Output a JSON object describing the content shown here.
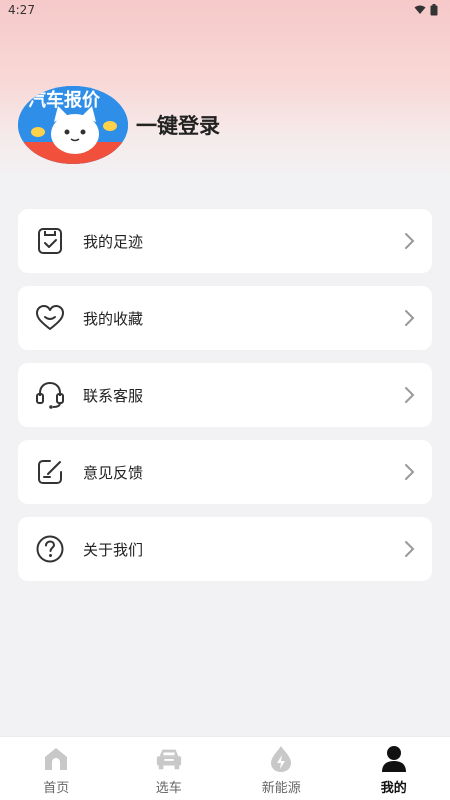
{
  "status_bar": {
    "time": "4:27",
    "icons": [
      "wifi-icon",
      "battery-icon"
    ]
  },
  "profile": {
    "avatar_banner_text": "汽车报价",
    "login_label": "一键登录"
  },
  "menu": {
    "items": [
      {
        "label": "我的足迹",
        "icon": "footprint-icon"
      },
      {
        "label": "我的收藏",
        "icon": "heart-icon"
      },
      {
        "label": "联系客服",
        "icon": "headset-icon"
      },
      {
        "label": "意见反馈",
        "icon": "feedback-edit-icon"
      },
      {
        "label": "关于我们",
        "icon": "question-icon"
      }
    ]
  },
  "tabbar": {
    "tabs": [
      {
        "label": "首页",
        "icon": "home-icon",
        "active": false
      },
      {
        "label": "选车",
        "icon": "car-icon",
        "active": false
      },
      {
        "label": "新能源",
        "icon": "energy-drop-icon",
        "active": false
      },
      {
        "label": "我的",
        "icon": "user-icon",
        "active": true
      }
    ]
  },
  "colors": {
    "header_gradient_top": "#f6c9c9",
    "page_background": "#f2f2f4",
    "card_background": "#ffffff",
    "text_primary": "#222222",
    "tab_inactive": "#666666",
    "tab_icon_inactive": "#c8c8c8",
    "tab_active": "#111111",
    "avatar_blue": "#2f8fe8"
  }
}
